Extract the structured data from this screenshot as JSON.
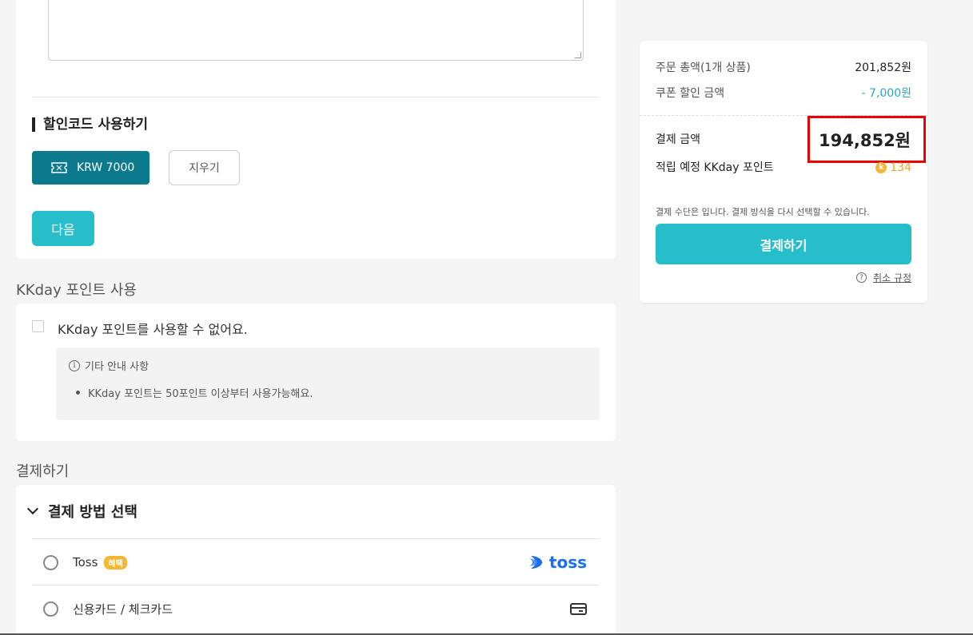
{
  "discount_section": {
    "title": "할인코드 사용하기",
    "coupon_label": "KRW 7000",
    "clear_label": "지우기",
    "next_label": "다음"
  },
  "points_section": {
    "heading": "KKday 포인트 사용",
    "checkbox_label": "KKday 포인트를 사용할 수 없어요.",
    "notice_title": "기타 안내 사항",
    "notice_items": [
      "KKday 포인트는 50포인트 이상부터 사용가능해요."
    ]
  },
  "payment_section": {
    "heading": "결제하기",
    "method_title": "결제 방법 선택",
    "methods": [
      {
        "label": "Toss",
        "badge": "혜택",
        "logo_text": "toss"
      },
      {
        "label": "신용카드 / 체크카드"
      }
    ]
  },
  "summary": {
    "order_total_label": "주문 총액(1개 상품)",
    "order_total_value": "201,852원",
    "coupon_label": "쿠폰 할인 금액",
    "coupon_value": "- 7,000원",
    "pay_amount_label": "결제 금액",
    "pay_amount_value": "194,852원",
    "point_label": "적립 예정 KKday 포인트",
    "point_value": "134",
    "note": "결제 수단은 입니다. 결제 방식을 다시 선택할 수 있습니다.",
    "pay_button": "결제하기",
    "cancel_policy": "취소 규정"
  },
  "colors": {
    "primary": "#26bec9",
    "dark_teal": "#0a7a8c",
    "highlight": "#ee0000",
    "point": "#f5a623",
    "toss_blue": "#1a6ef5"
  }
}
